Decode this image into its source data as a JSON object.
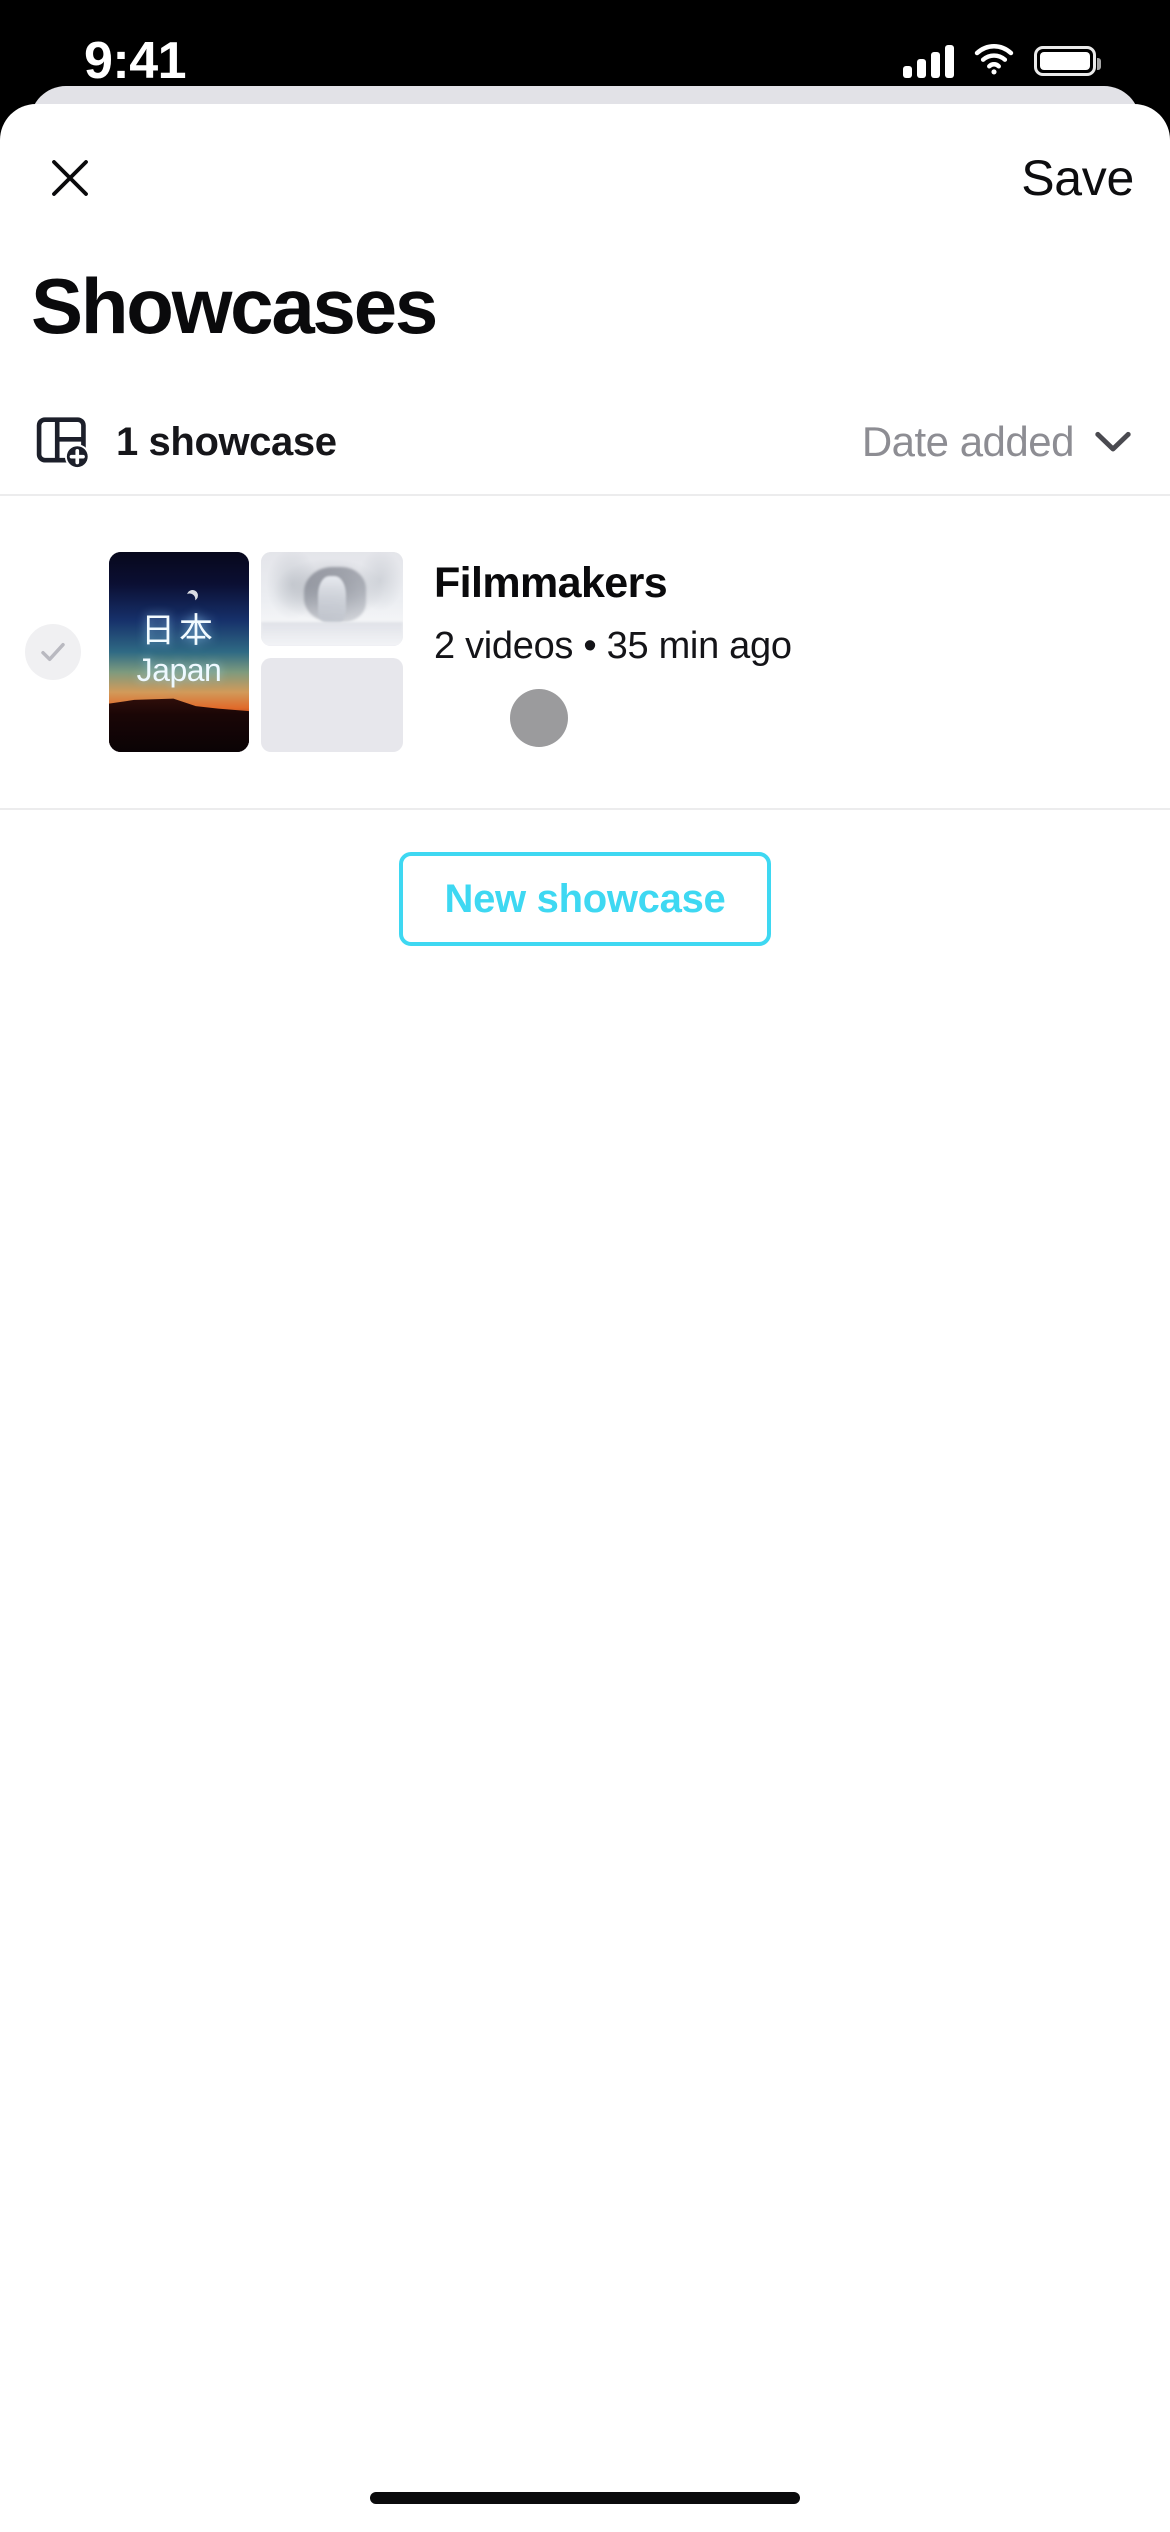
{
  "status_bar": {
    "time": "9:41",
    "signal_icon": "cellular-signal-icon",
    "wifi_icon": "wifi-icon",
    "battery_icon": "battery-icon"
  },
  "sheet": {
    "nav": {
      "close_icon": "close-icon",
      "save_label": "Save"
    },
    "title": "Showcases",
    "toolbar": {
      "showcase_icon": "showcase-add-icon",
      "count_label": "1 showcase",
      "sort_label": "Date added",
      "sort_chevron_icon": "chevron-down-icon"
    },
    "showcases": [
      {
        "selected": false,
        "check_icon": "check-icon",
        "title": "Filmmakers",
        "subtitle": "2 videos • 35 min ago",
        "video_count": "2 videos",
        "updated": "35 min ago",
        "avatar_icon": "avatar",
        "thumbnails": {
          "main": {
            "kanji": "日本",
            "romaji": "Japan"
          },
          "secondary_count": 2
        }
      }
    ],
    "new_showcase_label": "New showcase"
  },
  "colors": {
    "accent": "#3ed8f2",
    "text_primary": "#0a0a0c",
    "text_muted": "#8d8d93",
    "placeholder": "#e7e7ec",
    "avatar": "#9b9b9d",
    "sheet_bg": "#ffffff",
    "back_card": "#e2e2e7"
  }
}
